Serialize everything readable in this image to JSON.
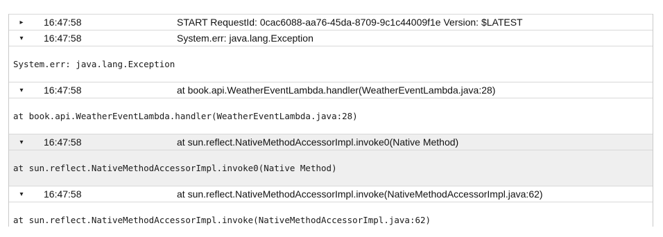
{
  "log": {
    "events": [
      {
        "toggle": "▸",
        "time": "16:47:58",
        "message": "START RequestId: 0cac6088-aa76-45da-8709-9c1c44009f1e Version: $LATEST"
      },
      {
        "toggle": "▾",
        "time": "16:47:58",
        "message": "System.err: java.lang.Exception",
        "detail": "System.err: java.lang.Exception"
      },
      {
        "toggle": "▾",
        "time": "16:47:58",
        "message": "at book.api.WeatherEventLambda.handler(WeatherEventLambda.java:28)",
        "detail": "at book.api.WeatherEventLambda.handler(WeatherEventLambda.java:28)"
      },
      {
        "toggle": "▾",
        "time": "16:47:58",
        "message": "at sun.reflect.NativeMethodAccessorImpl.invoke0(Native Method)",
        "detail": "at sun.reflect.NativeMethodAccessorImpl.invoke0(Native Method)"
      },
      {
        "toggle": "▾",
        "time": "16:47:58",
        "message": "at sun.reflect.NativeMethodAccessorImpl.invoke(NativeMethodAccessorImpl.java:62)",
        "detail": "at sun.reflect.NativeMethodAccessorImpl.invoke(NativeMethodAccessorImpl.java:62)"
      }
    ]
  }
}
